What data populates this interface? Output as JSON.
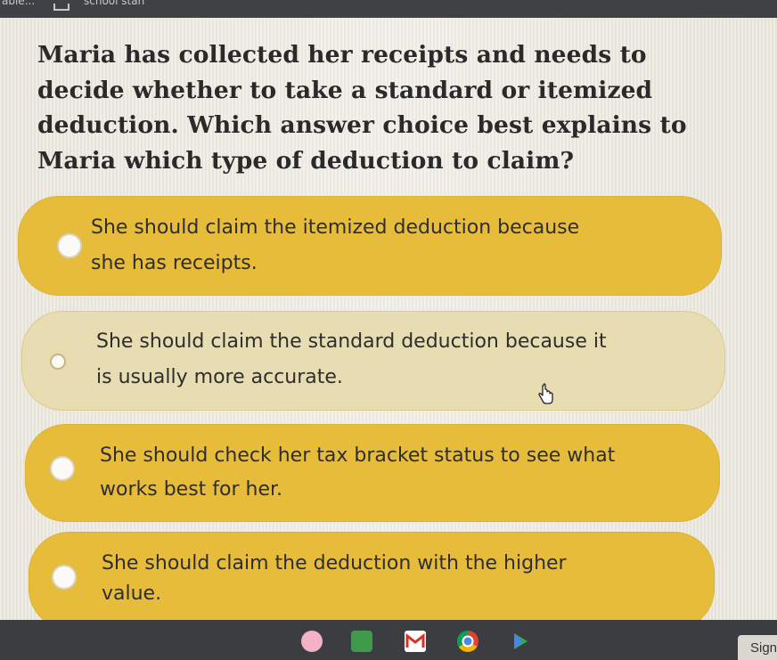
{
  "top_strip": {
    "left_fragment": "able...",
    "right_fragment": "school stan"
  },
  "question": "Maria has collected her receipts and needs to decide whether to take a standard or itemized deduction. Which answer choice best explains to Maria which type of deduction to claim?",
  "options": [
    {
      "line1": "She should claim the itemized deduction because",
      "line2": "she has receipts.",
      "selected": false
    },
    {
      "line1": "She should claim the standard deduction because it",
      "line2": "is usually more accurate.",
      "selected": true
    },
    {
      "line1": "She should check her tax bracket status to see what",
      "line2": "works best for her.",
      "selected": false
    },
    {
      "line1": "She should claim the deduction with the higher",
      "line2": "value.",
      "selected": false
    }
  ],
  "taskbar": {
    "apps": [
      {
        "name": "paint-app-icon",
        "color": "#f3b2c6"
      },
      {
        "name": "classroom-app-icon",
        "color": "#3f9a4c"
      },
      {
        "name": "gmail-app-icon",
        "color": "#ffffff"
      },
      {
        "name": "chrome-app-icon",
        "color": "#4f86e8"
      },
      {
        "name": "play-store-app-icon",
        "color": "#34a853"
      }
    ],
    "sign_label": "Sign"
  },
  "colors": {
    "option_bg": "#e7bc3b",
    "option_selected_bg": "#e7dcb2",
    "page_bg": "#ecebe3"
  }
}
